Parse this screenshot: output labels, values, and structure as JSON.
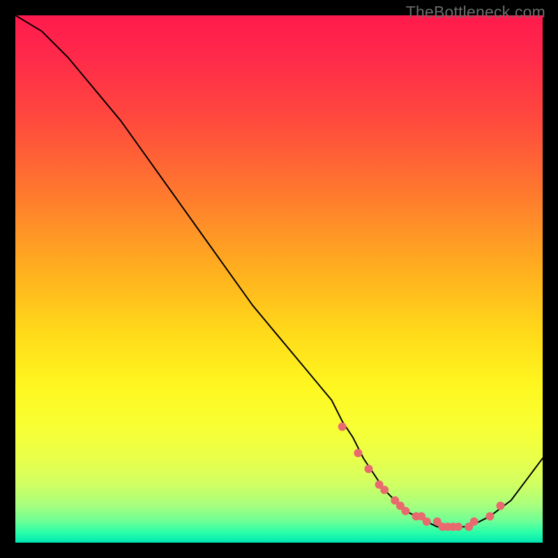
{
  "watermark": "TheBottleneck.com",
  "chart_data": {
    "type": "line",
    "title": "",
    "xlabel": "",
    "ylabel": "",
    "xlim": [
      0,
      100
    ],
    "ylim": [
      0,
      100
    ],
    "series": [
      {
        "name": "curve",
        "x": [
          0,
          5,
          10,
          15,
          20,
          25,
          30,
          35,
          40,
          45,
          50,
          55,
          60,
          62,
          64,
          66,
          68,
          70,
          72,
          74,
          76,
          78,
          80,
          82,
          84,
          86,
          88,
          90,
          94,
          100
        ],
        "y": [
          100,
          97,
          92,
          86,
          80,
          73,
          66,
          59,
          52,
          45,
          39,
          33,
          27,
          23,
          20,
          16,
          13,
          10,
          8,
          6,
          5,
          4,
          3,
          3,
          3,
          3,
          4,
          5,
          8,
          16
        ]
      }
    ],
    "markers": {
      "name": "highlight-dots",
      "x": [
        62,
        65,
        67,
        69,
        70,
        72,
        73,
        74,
        76,
        77,
        78,
        80,
        81,
        82,
        83,
        84,
        86,
        87,
        90,
        92
      ],
      "y": [
        22,
        17,
        14,
        11,
        10,
        8,
        7,
        6,
        5,
        5,
        4,
        4,
        3,
        3,
        3,
        3,
        3,
        4,
        5,
        7
      ]
    },
    "background": "rainbow-vertical-gradient"
  }
}
